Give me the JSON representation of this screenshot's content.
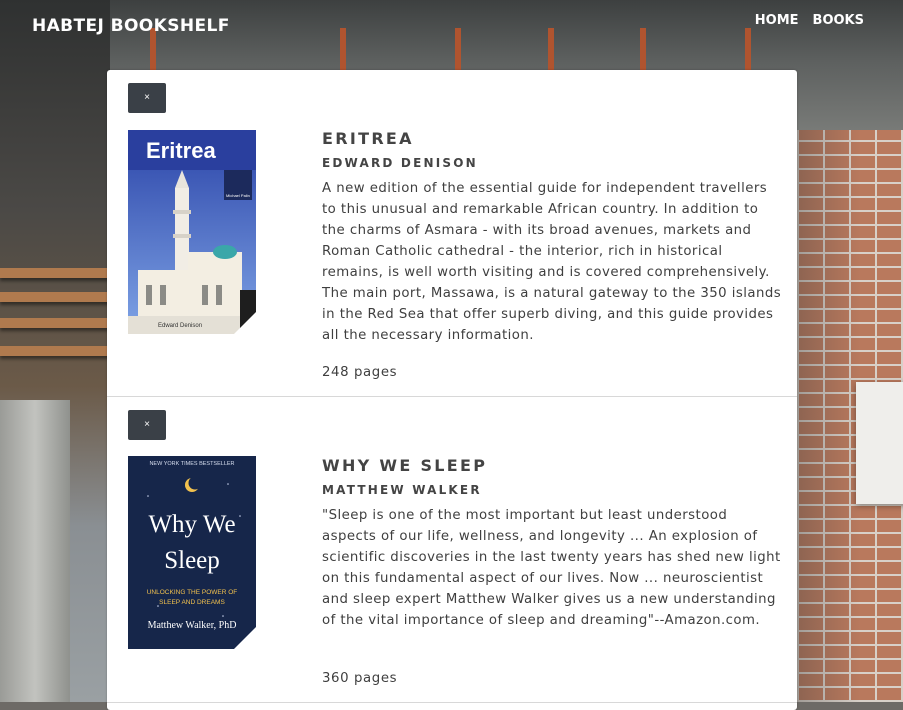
{
  "nav": {
    "brand": "HABTEJ BOOKSHELF",
    "links": [
      "HOME",
      "BOOKS"
    ]
  },
  "colors": {
    "button_bg": "#3a4047",
    "text": "#3f3f3f",
    "panel_bg": "#ffffff"
  },
  "books": [
    {
      "remove_label": "×",
      "cover": {
        "title": "Eritrea",
        "author": "Edward Denison",
        "badge_text": "Michael Palin"
      },
      "title": "ERITREA",
      "author": "EDWARD DENISON",
      "description": "A new edition of the essential guide for independent travellers to this unusual and remarkable African country. In addition to the charms of Asmara - with its broad avenues, markets and Roman Catholic cathedral - the interior, rich in historical remains, is well worth visiting and is covered comprehensively. The main port, Massawa, is a natural gateway to the 350 islands in the Red Sea that offer superb diving, and this guide provides all the necessary information.",
      "pages": "248 pages"
    },
    {
      "remove_label": "×",
      "cover": {
        "banner": "NEW YORK TIMES BESTSELLER",
        "title_line1": "Why We",
        "title_line2": "Sleep",
        "subtitle_line1": "UNLOCKING THE POWER OF",
        "subtitle_line2": "SLEEP AND DREAMS",
        "author": "Matthew Walker, PhD"
      },
      "title": "WHY WE SLEEP",
      "author": "MATTHEW WALKER",
      "description": "\"Sleep is one of the most important but least understood aspects of our life, wellness, and longevity ... An explosion of scientific discoveries in the last twenty years has shed new light on this fundamental aspect of our lives. Now ... neuroscientist and sleep expert Matthew Walker gives us a new understanding of the vital importance of sleep and dreaming\"--Amazon.com.",
      "pages": "360 pages"
    }
  ]
}
